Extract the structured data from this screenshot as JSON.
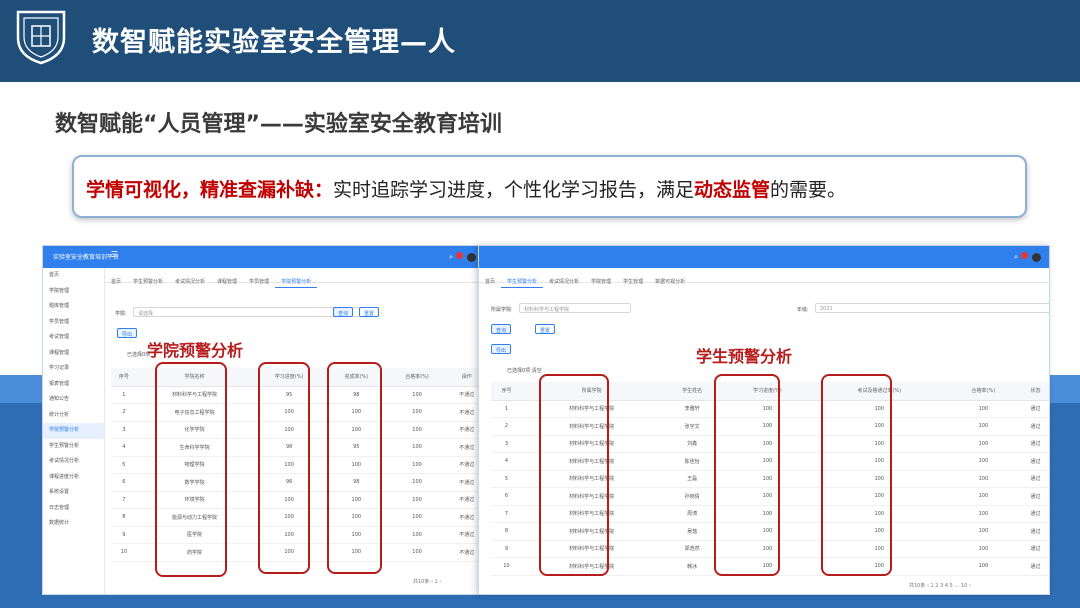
{
  "page_title": "数智赋能实验室安全管理—人",
  "subtitle": "数智赋能“人员管理”——实验室安全教育培训",
  "callout": {
    "highlight1": "学情可视化，精准查漏补缺：",
    "text1": "实时追踪学习进度，个性化学习报告，满足",
    "highlight2": "动态监管",
    "text2": "的需要。"
  },
  "colors": {
    "header_bg": "#1f4e79",
    "accent_red": "#c00000",
    "app_blue": "#2f80ed"
  },
  "left_panel": {
    "app_name": "实验室安全教育培训平台",
    "sidebar": [
      "首页",
      "学院管理",
      "题库管理",
      "学员管理",
      "考试管理",
      "课程管理",
      "学习记录",
      "报表管理",
      "通知公告",
      "统计分析",
      "学院预警分析",
      "学生预警分析",
      "考试情况分析",
      "课程进度分析",
      "系统设置",
      "日志管理",
      "数据统计"
    ],
    "sidebar_active_index": 10,
    "tabs": [
      "首页",
      "学生预警分析",
      "考试情况分析",
      "课程管理",
      "学员管理",
      "学院预警分析"
    ],
    "active_tab_index": 5,
    "search_label": "学院:",
    "search_value": "请选择",
    "search_btn": "查询",
    "reset_btn": "重置",
    "export_btn": "导出",
    "filter_text": "已选择0项",
    "overlay_label": "学院预警分析",
    "columns": [
      "序号",
      "学院名称",
      "学习进度(%)",
      "完成率(%)",
      "合格率(%)",
      "操作"
    ],
    "rows": [
      [
        "1",
        "材料科学与工程学院",
        "95",
        "98",
        "100",
        "不通过"
      ],
      [
        "2",
        "电子信息工程学院",
        "100",
        "100",
        "100",
        "不通过"
      ],
      [
        "3",
        "化学学院",
        "100",
        "100",
        "100",
        "不通过"
      ],
      [
        "4",
        "生命科学学院",
        "98",
        "95",
        "100",
        "不通过"
      ],
      [
        "5",
        "物理学院",
        "100",
        "100",
        "100",
        "不通过"
      ],
      [
        "6",
        "数学学院",
        "96",
        "98",
        "100",
        "不通过"
      ],
      [
        "7",
        "环境学院",
        "100",
        "100",
        "100",
        "不通过"
      ],
      [
        "8",
        "能源与动力工程学院",
        "100",
        "100",
        "100",
        "不通过"
      ],
      [
        "9",
        "医学院",
        "100",
        "100",
        "100",
        "不通过"
      ],
      [
        "10",
        "药学院",
        "100",
        "100",
        "100",
        "不通过"
      ]
    ],
    "pager": "共10条 ‹ 1 ›"
  },
  "right_panel": {
    "tabs": [
      "首页",
      "学生预警分析",
      "考试情况分析",
      "学院管理",
      "学生管理",
      "数据可视分析"
    ],
    "active_tab_index": 1,
    "college_label": "所属学院:",
    "college_value": "材料科学与工程学院",
    "year_label": "年级:",
    "year_value": "2021",
    "search_btn": "查询",
    "reset_btn": "重置",
    "export_btn": "导出",
    "filter_text": "已选择0项  清空",
    "overlay_label": "学生预警分析",
    "columns": [
      "序号",
      "所属学院",
      "学生姓名",
      "学习进度(%)",
      "考试及格通过率(%)",
      "合格率(%)",
      "状态"
    ],
    "rows": [
      [
        "1",
        "材料科学与工程学院",
        "李雅轩",
        "100",
        "100",
        "100",
        "通过"
      ],
      [
        "2",
        "材料科学与工程学院",
        "张宇文",
        "100",
        "100",
        "100",
        "通过"
      ],
      [
        "3",
        "材料科学与工程学院",
        "刘鑫",
        "100",
        "100",
        "100",
        "通过"
      ],
      [
        "4",
        "材料科学与工程学院",
        "陈佳怡",
        "100",
        "100",
        "100",
        "通过"
      ],
      [
        "5",
        "材料科学与工程学院",
        "王磊",
        "100",
        "100",
        "100",
        "通过"
      ],
      [
        "6",
        "材料科学与工程学院",
        "孙晓倩",
        "100",
        "100",
        "100",
        "通过"
      ],
      [
        "7",
        "材料科学与工程学院",
        "周涛",
        "100",
        "100",
        "100",
        "通过"
      ],
      [
        "8",
        "材料科学与工程学院",
        "吴悠",
        "100",
        "100",
        "100",
        "通过"
      ],
      [
        "9",
        "材料科学与工程学院",
        "郑浩然",
        "100",
        "100",
        "100",
        "通过"
      ],
      [
        "10",
        "材料科学与工程学院",
        "韩冰",
        "100",
        "100",
        "100",
        "通过"
      ]
    ],
    "pager": "共10条 ‹ 1 2 3 4 5 … 10 ›"
  }
}
